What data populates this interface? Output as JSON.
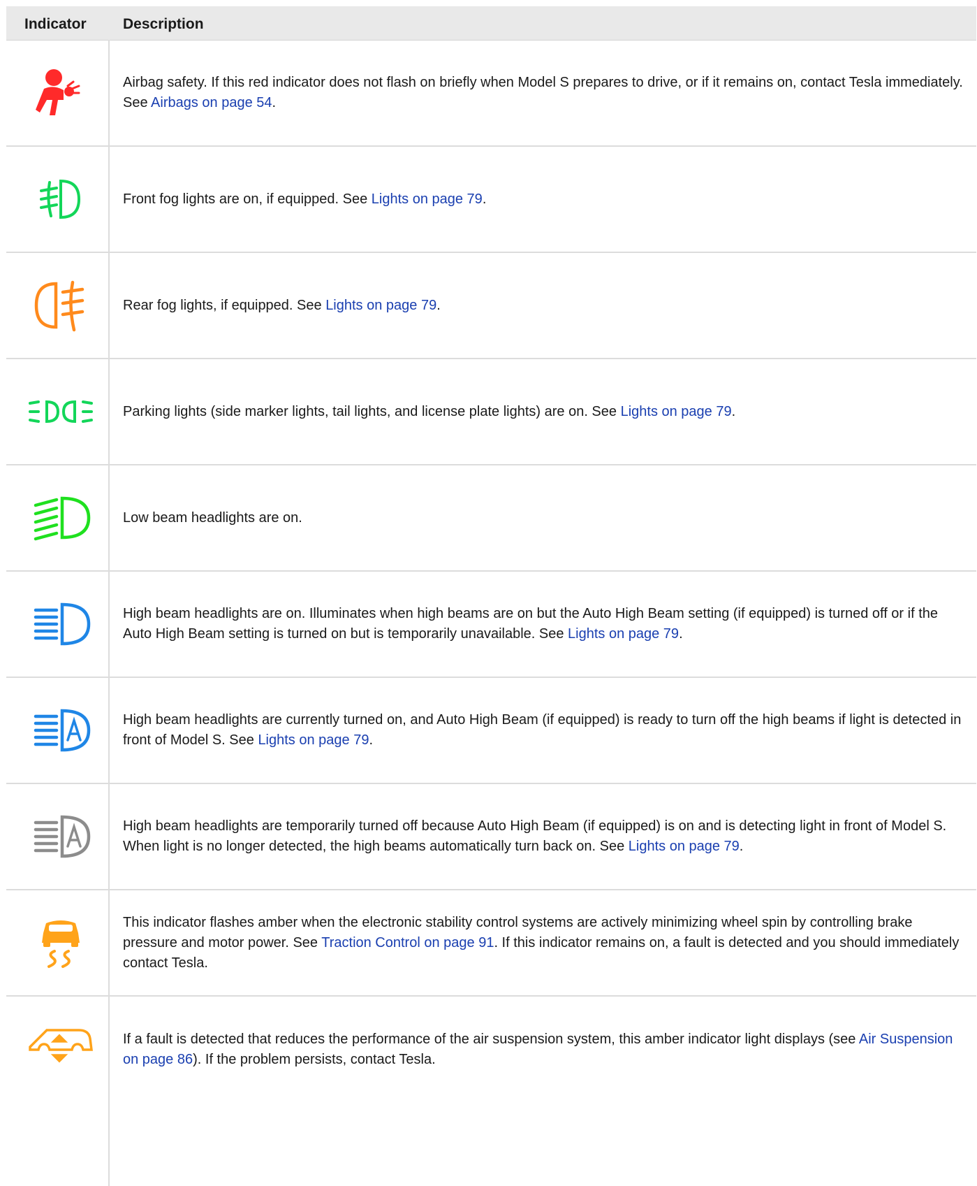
{
  "header": {
    "col1": "Indicator",
    "col2": "Description"
  },
  "rows": [
    {
      "icon": "airbag-warning-icon",
      "color": "#ff2a2a",
      "pre": "Airbag safety. If this red indicator does not flash on briefly when Model S prepares to drive, or if it remains on, contact Tesla immediately. See ",
      "link": "Airbags on page 54",
      "post": "."
    },
    {
      "icon": "front-fog-lights-icon",
      "color": "#13d659",
      "pre": "Front fog lights are on, if equipped. See ",
      "link": "Lights on page 79",
      "post": "."
    },
    {
      "icon": "rear-fog-lights-icon",
      "color": "#ff8a1c",
      "pre": "Rear fog lights, if equipped. See ",
      "link": "Lights on page 79",
      "post": "."
    },
    {
      "icon": "parking-lights-icon",
      "color": "#13d659",
      "pre": "Parking lights (side marker lights, tail lights, and license plate lights) are on. See ",
      "link": "Lights on page 79",
      "post": "."
    },
    {
      "icon": "low-beam-headlights-icon",
      "color": "#1fe01f",
      "pre": "Low beam headlights are on.",
      "link": "",
      "post": ""
    },
    {
      "icon": "high-beam-headlights-icon",
      "color": "#1f86e6",
      "pre": "High beam headlights are on. Illuminates when high beams are on but the Auto High Beam setting (if equipped) is turned off or if the Auto High Beam setting is turned on but is temporarily unavailable. See ",
      "link": "Lights on page 79",
      "post": "."
    },
    {
      "icon": "auto-high-beam-on-icon",
      "color": "#1f86e6",
      "pre": "High beam headlights are currently turned on, and Auto High Beam (if equipped) is ready to turn off the high beams if light is detected in front of Model S. See ",
      "link": "Lights on page 79",
      "post": "."
    },
    {
      "icon": "auto-high-beam-off-icon",
      "color": "#8c8c8c",
      "pre": "High beam headlights are temporarily turned off because Auto High Beam (if equipped) is on and is detecting light in front of Model S. When light is no longer detected, the high beams automatically turn back on. See ",
      "link": "Lights on page 79",
      "post": "."
    },
    {
      "icon": "traction-control-icon",
      "color": "#ffa31a",
      "pre": "This indicator flashes amber when the electronic stability control systems are actively minimizing wheel spin by controlling brake pressure and motor power. See ",
      "link": "Traction Control on page 91",
      "post": ". If this indicator remains on, a fault is detected and you should immediately contact Tesla."
    },
    {
      "icon": "air-suspension-icon",
      "color": "#ffa31a",
      "pre": "If a fault is detected that reduces the performance of the air suspension system, this amber indicator light displays (see ",
      "link": "Air Suspension on page 86",
      "post": "). If the problem persists, contact Tesla."
    }
  ]
}
